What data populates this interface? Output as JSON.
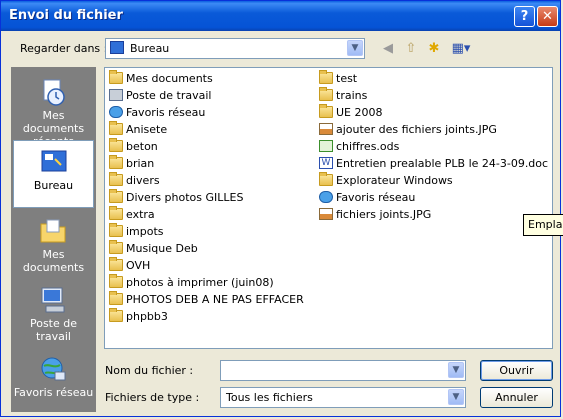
{
  "window": {
    "title": "Envoi du fichier",
    "help_glyph": "?",
    "close_glyph": "✕"
  },
  "lookin": {
    "label": "Regarder dans :",
    "value": "Bureau"
  },
  "toolbar": {
    "back_glyph": "◀",
    "up_glyph": "⇧",
    "newfolder_glyph": "✱",
    "views_glyph": "▦▾"
  },
  "places": [
    {
      "label": "Mes documents récents",
      "icon": "recent-documents-icon"
    },
    {
      "label": "Bureau",
      "icon": "desktop-icon"
    },
    {
      "label": "Mes documents",
      "icon": "my-documents-icon"
    },
    {
      "label": "Poste de travail",
      "icon": "my-computer-icon"
    },
    {
      "label": "Favoris réseau",
      "icon": "network-places-icon"
    }
  ],
  "files_col1": [
    {
      "name": "Mes documents",
      "type": "special-folder"
    },
    {
      "name": "Poste de travail",
      "type": "computer"
    },
    {
      "name": "Favoris réseau",
      "type": "network"
    },
    {
      "name": "Anisete",
      "type": "folder"
    },
    {
      "name": "beton",
      "type": "folder"
    },
    {
      "name": "brian",
      "type": "folder"
    },
    {
      "name": "divers",
      "type": "folder"
    },
    {
      "name": "Divers photos GILLES",
      "type": "folder"
    },
    {
      "name": "extra",
      "type": "folder"
    },
    {
      "name": "impots",
      "type": "folder"
    },
    {
      "name": "Musique Deb",
      "type": "folder"
    },
    {
      "name": "OVH",
      "type": "folder"
    },
    {
      "name": "photos à imprimer (juin08)",
      "type": "folder"
    },
    {
      "name": "PHOTOS DEB A NE PAS EFFACER",
      "type": "folder"
    },
    {
      "name": "phpbb3",
      "type": "folder"
    }
  ],
  "files_col2": [
    {
      "name": "test",
      "type": "folder"
    },
    {
      "name": "trains",
      "type": "folder"
    },
    {
      "name": "UE 2008",
      "type": "folder"
    },
    {
      "name": "ajouter des fichiers joints.JPG",
      "type": "jpg"
    },
    {
      "name": "chiffres.ods",
      "type": "ods"
    },
    {
      "name": "Entretien prealable PLB le 24-3-09.doc",
      "type": "doc"
    },
    {
      "name": "Explorateur Windows",
      "type": "shortcut"
    },
    {
      "name": "Favoris réseau",
      "type": "shortcut-network"
    },
    {
      "name": "fichiers joints.JPG",
      "type": "jpg"
    }
  ],
  "filename": {
    "label": "Nom du fichier :",
    "value": ""
  },
  "filetype": {
    "label": "Fichiers de type :",
    "value": "Tous les fichiers"
  },
  "buttons": {
    "open": "Ouvrir",
    "cancel": "Annuler"
  },
  "tooltip": {
    "text": "Emplace"
  },
  "colors": {
    "title_bar": "#0a5ad8",
    "face": "#ece9d8",
    "places_bg": "#7f7f7f",
    "border": "#7f9db9"
  }
}
